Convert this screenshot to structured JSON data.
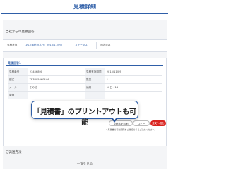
{
  "header": {
    "title": "見積詳細",
    "back_icon": "chevron-left-icon"
  },
  "section1": {
    "title": "当社からの見積回答"
  },
  "summary": [
    {
      "label": "見積状態",
      "value": "",
      "blue": false
    },
    {
      "label": "1件 (最終回答日：2015/11/09)",
      "value": "",
      "blue": true
    },
    {
      "label": "ステータス",
      "value": "",
      "blue": false
    },
    {
      "label": "回答済み",
      "value": "",
      "blue": false
    }
  ],
  "detail": {
    "title": "見積回答1",
    "rows": [
      [
        "見積番号",
        "23456890",
        "見積有効期限",
        "2015/11/09"
      ],
      [
        "型式",
        "TE3B0506044A",
        "数量",
        "1"
      ],
      [
        "メーカー",
        "その他",
        "納期",
        "10日～14"
      ],
      [
        "単価",
        "",
        "",
        ""
      ]
    ]
  },
  "buttons": {
    "print": "見積書を印刷",
    "copy": "コピー",
    "order": "注文へ進む"
  },
  "note": "※見積書の有効期限をご確認のうえご注文ください。",
  "callout": {
    "text": "「見積書」のプリントアウトも可能"
  },
  "section2": {
    "title": "ご発送方法"
  },
  "footer": {
    "text": "一覧を見る"
  }
}
